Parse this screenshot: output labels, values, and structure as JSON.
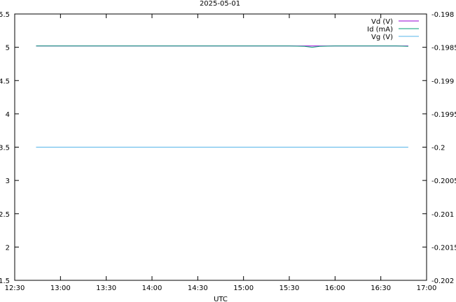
{
  "chart_data": {
    "type": "line",
    "title": "2025-05-01",
    "xlabel": "UTC",
    "x_ticks": [
      "12:30",
      "13:00",
      "13:30",
      "14:00",
      "14:30",
      "15:00",
      "15:30",
      "16:00",
      "16:30",
      "17:00"
    ],
    "xlim": [
      "12:30",
      "17:00"
    ],
    "y_left_ticks": [
      "1.5",
      "2",
      "2.5",
      "3",
      "3.5",
      "4",
      "4.5",
      "5",
      "5.5"
    ],
    "ylim_left": [
      1.5,
      5.5
    ],
    "y_right_ticks": [
      "-0.202",
      "-0.2015",
      "-0.201",
      "-0.2005",
      "-0.2",
      "-0.1995",
      "-0.199",
      "-0.1985",
      "-0.198"
    ],
    "ylim_right": [
      -0.202,
      -0.198
    ],
    "grid": false,
    "legend_position": "top-right",
    "series": [
      {
        "name": "Vd (V)",
        "color": "#9400d3",
        "axis": "left",
        "x": [
          "12:44",
          "16:48"
        ],
        "values": [
          5.02,
          5.02
        ]
      },
      {
        "name": "Id (mA)",
        "color": "#009e73",
        "axis": "left",
        "x": [
          "12:44",
          "13:00",
          "13:10",
          "13:20",
          "13:30",
          "13:40",
          "13:50",
          "14:00",
          "14:10",
          "14:20",
          "14:30",
          "14:40",
          "14:50",
          "15:00",
          "15:10",
          "15:20",
          "15:30",
          "15:40",
          "15:45",
          "15:50",
          "16:00",
          "16:10",
          "16:20",
          "16:30",
          "16:40",
          "16:48"
        ],
        "values": [
          5.02,
          5.02,
          5.02,
          5.02,
          5.02,
          5.02,
          5.02,
          5.02,
          5.02,
          5.02,
          5.02,
          5.02,
          5.02,
          5.02,
          5.02,
          5.02,
          5.02,
          5.015,
          5.0,
          5.015,
          5.02,
          5.02,
          5.02,
          5.02,
          5.02,
          5.015
        ]
      },
      {
        "name": "Vg (V)",
        "color": "#56b4e9",
        "axis": "left",
        "x": [
          "12:44",
          "16:48"
        ],
        "values": [
          3.5,
          3.5
        ]
      }
    ]
  }
}
